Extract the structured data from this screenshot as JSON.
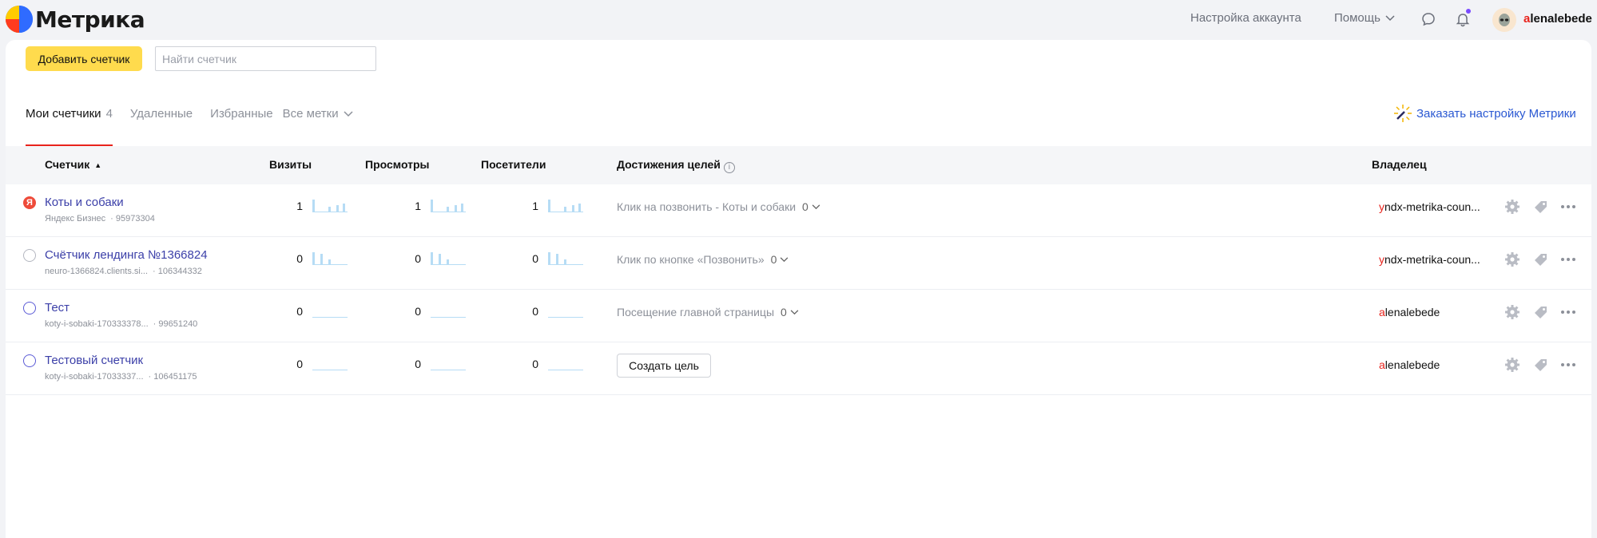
{
  "app": {
    "logo_text": "Метрика"
  },
  "header": {
    "account_settings": "Настройка аккаунта",
    "help": "Помощь",
    "user_first": "a",
    "user_rest": "lenalebede"
  },
  "toolbar": {
    "add_counter": "Добавить счетчик",
    "search_placeholder": "Найти счетчик"
  },
  "tabs": {
    "my_counters": "Мои счетчики",
    "my_counters_count": "4",
    "deleted": "Удаленные",
    "favorites": "Избранные",
    "all_tags": "Все метки"
  },
  "order_setup": "Заказать настройку Метрики",
  "table": {
    "columns": {
      "counter": "Счетчик",
      "sort_arrow": "▲",
      "visits": "Визиты",
      "views": "Просмотры",
      "visitors": "Посетители",
      "goals": "Достижения целей",
      "owner": "Владелец"
    },
    "rows": [
      {
        "icon": "yandex-business-icon",
        "name": "Коты и собаки",
        "sub": "Яндекс Бизнес",
        "id": "· 95973304",
        "visits": "1",
        "views": "1",
        "visitors": "1",
        "goal": "Клик на позвонить - Коты и собаки",
        "goal_count": "0",
        "owner_first": "y",
        "owner_rest": "ndx-metrika-coun..."
      },
      {
        "icon": "globe-icon",
        "name": "Счётчик лендинга №1366824",
        "sub": "neuro-1366824.clients.si...",
        "id": "· 106344332",
        "visits": "0",
        "views": "0",
        "visitors": "0",
        "goal": "Клик по кнопке «Позвонить»",
        "goal_count": "0",
        "owner_first": "y",
        "owner_rest": "ndx-metrika-coun..."
      },
      {
        "icon": "globe-icon",
        "name": "Тест",
        "sub": "koty-i-sobaki-170333378...",
        "id": "· 99651240",
        "visits": "0",
        "views": "0",
        "visitors": "0",
        "goal": "Посещение главной страницы",
        "goal_count": "0",
        "owner_first": "a",
        "owner_rest": "lenalebede"
      },
      {
        "icon": "globe-icon",
        "name": "Тестовый счетчик",
        "sub": "koty-i-sobaki-17033337...",
        "id": "· 106451175",
        "visits": "0",
        "views": "0",
        "visitors": "0",
        "create_goal": "Создать цель",
        "owner_first": "a",
        "owner_rest": "lenalebede"
      }
    ]
  },
  "colors": {
    "accent_yellow": "#ffdb4d",
    "link_blue": "#2a58d2",
    "brand_red": "#e8231c"
  }
}
